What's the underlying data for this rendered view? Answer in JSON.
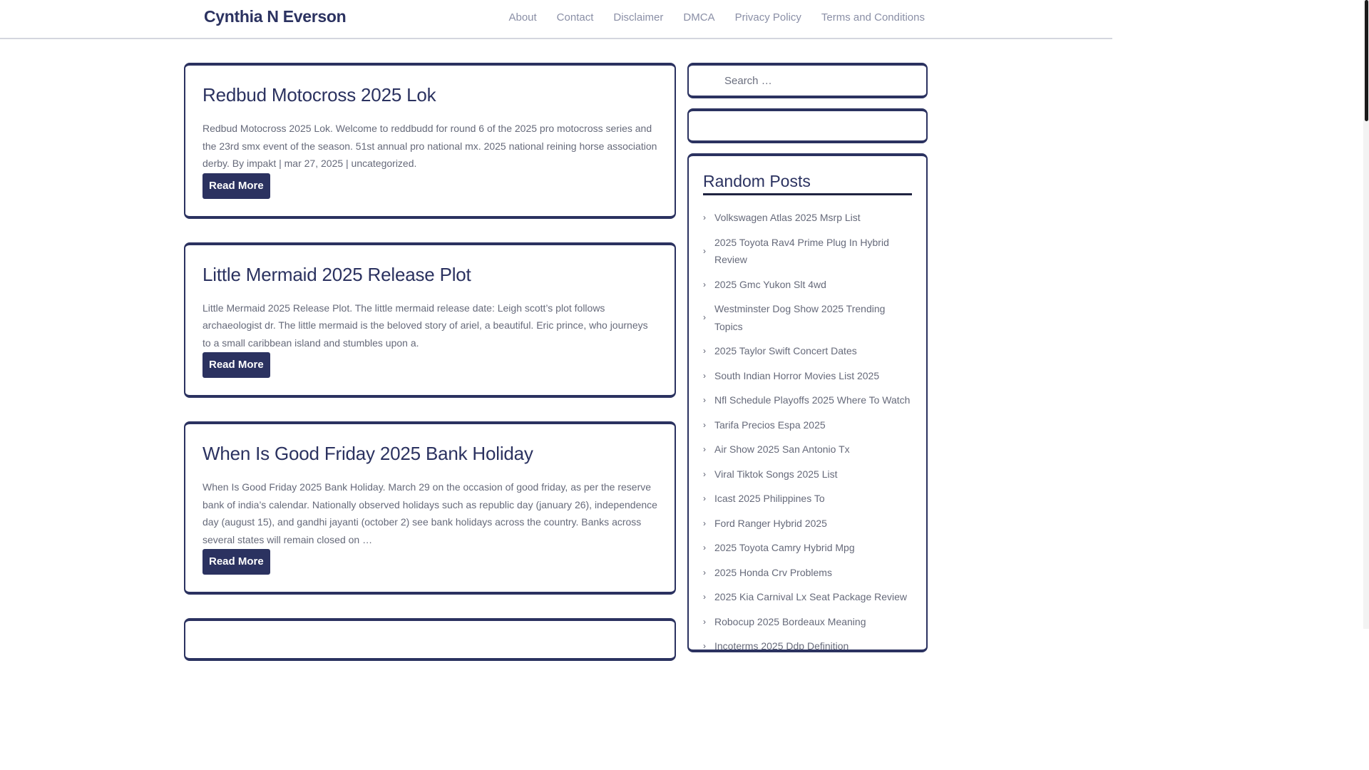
{
  "site": {
    "title": "Cynthia N Everson"
  },
  "nav": {
    "items": [
      {
        "label": "About"
      },
      {
        "label": "Contact"
      },
      {
        "label": "Disclaimer"
      },
      {
        "label": "DMCA"
      },
      {
        "label": "Privacy Policy"
      },
      {
        "label": "Terms and Conditions"
      }
    ]
  },
  "posts": [
    {
      "title": "Redbud Motocross 2025 Lok",
      "excerpt": "Redbud Motocross 2025 Lok. Welcome to reddbudd for round 6 of the 2025 pro motocross series and the 23rd smx event of the season. 51st annual pro national mx. 2025 national reining horse association derby. By impakt | mar 27, 2025 | uncategorized.",
      "button": "Read More"
    },
    {
      "title": "Little Mermaid 2025 Release Plot",
      "excerpt": "Little Mermaid 2025 Release Plot. The little mermaid release date: Leigh scott’s plot follows archaeologist dr. The little mermaid is the beloved story of ariel, a beautiful. Eric prince, who journeys to a small caribbean island and stumbles upon a.",
      "button": "Read More"
    },
    {
      "title": "When Is Good Friday 2025 Bank Holiday",
      "excerpt": "When Is Good Friday 2025 Bank Holiday. March 29 on the occasion of good friday, as per the reserve bank of india’s calendar. Nationally observed holidays such as republic day (january 26), independence day (august 15), and gandhi jayanti (october 2) see bank holidays across the country. Banks across several states will remain closed on …",
      "button": "Read More"
    }
  ],
  "sidebar": {
    "search": {
      "placeholder": "Search …"
    },
    "random_posts": {
      "title": "Random Posts",
      "items": [
        "Volkswagen Atlas 2025 Msrp List",
        "2025 Toyota Rav4 Prime Plug In Hybrid Review",
        "2025 Gmc Yukon Slt 4wd",
        "Westminster Dog Show 2025 Trending Topics",
        "2025 Taylor Swift Concert Dates",
        "South Indian Horror Movies List 2025",
        "Nfl Schedule Playoffs 2025 Where To Watch",
        "Tarifa Precios Espa 2025",
        "Air Show 2025 San Antonio Tx",
        "Viral Tiktok Songs 2025 List",
        "Icast 2025 Philippines To",
        "Ford Ranger Hybrid 2025",
        "2025 Toyota Camry Hybrid Mpg",
        "2025 Honda Crv Problems",
        "2025 Kia Carnival Lx Seat Package Review",
        "Robocup 2025 Bordeaux Meaning",
        "Incoterms 2025 Ddp Definition"
      ]
    }
  },
  "colors": {
    "brand": "#2b3260",
    "text": "#666a7a",
    "nav": "#8a8fa6"
  }
}
